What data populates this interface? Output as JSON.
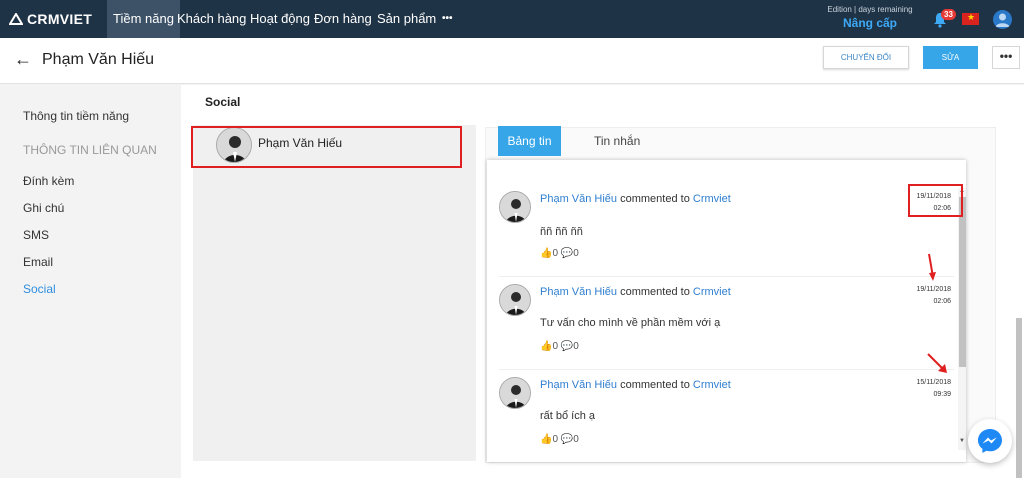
{
  "nav": {
    "logo_text": "CRMVIET",
    "items": [
      "Tiềm năng",
      "Khách hàng",
      "Hoạt động",
      "Đơn hàng",
      "Sản phẩm"
    ],
    "more": "•••",
    "edition_text": "Edition | days remaining",
    "upgrade_label": "Nâng cấp",
    "notification_count": "33",
    "colors": {
      "bar": "#1f3346",
      "accent": "#36a6e8"
    }
  },
  "header": {
    "back": "←",
    "title": "Phạm Văn Hiếu",
    "convert_label": "CHUYỂN ĐỔI",
    "edit_label": "SỬA",
    "more_label": "•••"
  },
  "sidebar": {
    "items": [
      {
        "label": "Thông tin tiềm năng"
      },
      {
        "label": "THÔNG TIN LIÊN QUAN"
      },
      {
        "label": "Đính kèm"
      },
      {
        "label": "Ghi chú"
      },
      {
        "label": "SMS"
      },
      {
        "label": "Email"
      },
      {
        "label": "Social"
      }
    ]
  },
  "main": {
    "section_title": "Social",
    "contact": {
      "name": "Phạm Văn Hiếu"
    },
    "tabs": [
      {
        "label": "Bảng tin"
      },
      {
        "label": "Tin nhắn"
      }
    ],
    "posts": [
      {
        "author": "Phạm Văn Hiếu",
        "action": "commented to",
        "target": "Crmviet",
        "date": "19/11/2018",
        "time": "02:06",
        "body": "ññ ññ ññ",
        "likes": "0",
        "comments": "0"
      },
      {
        "author": "Phạm Văn Hiếu",
        "action": "commented to",
        "target": "Crmviet",
        "date": "19/11/2018",
        "time": "02:06",
        "body": "Tư vấn cho mình về phần mềm với ạ",
        "likes": "0",
        "comments": "0"
      },
      {
        "author": "Phạm Văn Hiếu",
        "action": "commented to",
        "target": "Crmviet",
        "date": "15/11/2018",
        "time": "09:39",
        "body": "rất bổ ích ạ",
        "likes": "0",
        "comments": "0"
      }
    ]
  }
}
